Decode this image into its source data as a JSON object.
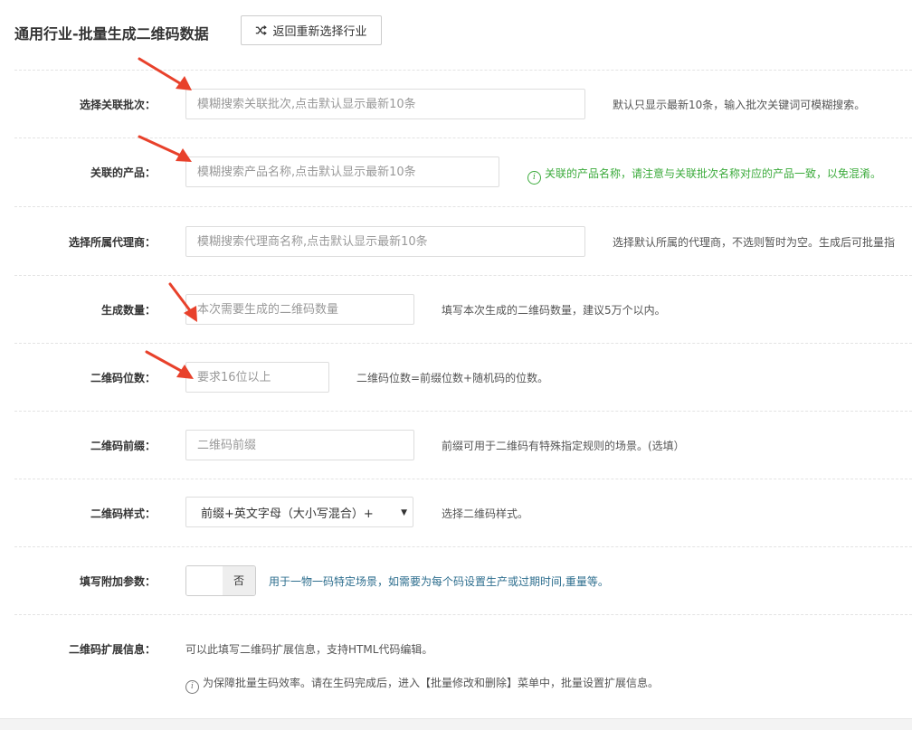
{
  "header": {
    "title": "通用行业-批量生成二维码数据",
    "back_button": "返回重新选择行业"
  },
  "form": {
    "batch": {
      "label": "选择关联批次：",
      "placeholder": "模糊搜索关联批次,点击默认显示最新10条",
      "hint": "默认只显示最新10条，输入批次关键词可模糊搜索。"
    },
    "product": {
      "label": "关联的产品：",
      "placeholder": "模糊搜索产品名称,点击默认显示最新10条",
      "hint": "关联的产品名称，请注意与关联批次名称对应的产品一致，以免混淆。"
    },
    "agent": {
      "label": "选择所属代理商：",
      "placeholder": "模糊搜索代理商名称,点击默认显示最新10条",
      "hint": "选择默认所属的代理商，不选则暂时为空。生成后可批量指"
    },
    "quantity": {
      "label": "生成数量：",
      "placeholder": "本次需要生成的二维码数量",
      "hint": "填写本次生成的二维码数量，建议5万个以内。"
    },
    "digits": {
      "label": "二维码位数：",
      "placeholder": "要求16位以上",
      "hint": "二维码位数=前缀位数+随机码的位数。"
    },
    "prefix": {
      "label": "二维码前缀：",
      "placeholder": "二维码前缀",
      "hint": "前缀可用于二维码有特殊指定规则的场景。(选填）"
    },
    "style": {
      "label": "二维码样式：",
      "selected": "前缀+英文字母（大小写混合）+",
      "hint": "选择二维码样式。"
    },
    "extra_params": {
      "label": "填写附加参数：",
      "toggle_state": "否",
      "hint": "用于一物一码特定场景，如需要为每个码设置生产或过期时间,重量等。"
    },
    "ext_info": {
      "label": "二维码扩展信息：",
      "desc": "可以此填写二维码扩展信息，支持HTML代码编辑。",
      "note": "为保障批量生码效率。请在生码完成后，进入【批量修改和删除】菜单中，批量设置扩展信息。"
    }
  },
  "colors": {
    "accent_green": "#3cab3c",
    "accent_blue": "#2d6e8e",
    "arrow_red": "#e8412b"
  }
}
